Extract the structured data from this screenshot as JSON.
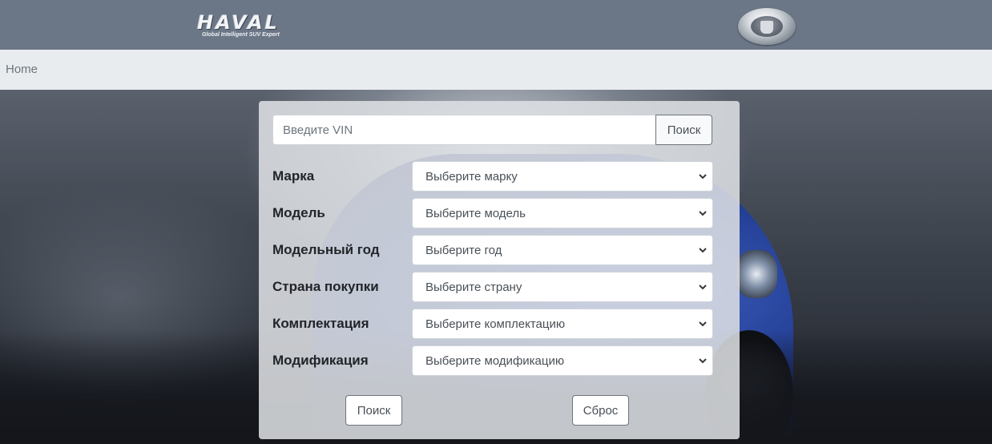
{
  "header": {
    "logo_text": "HAVAL",
    "logo_tagline": "Global Intelligent SUV Expert"
  },
  "breadcrumb": {
    "home_label": "Home"
  },
  "vin_search": {
    "placeholder": "Введите VIN",
    "button_label": "Поиск"
  },
  "filters": [
    {
      "label": "Марка",
      "value": "Выберите марку"
    },
    {
      "label": "Модель",
      "value": "Выберите модель"
    },
    {
      "label": "Модельный год",
      "value": "Выберите год"
    },
    {
      "label": "Страна покупки",
      "value": "Выберите страну"
    },
    {
      "label": "Комплектация",
      "value": "Выберите комплектацию"
    },
    {
      "label": "Модификация",
      "value": "Выберите модификацию"
    }
  ],
  "actions": {
    "search_label": "Поиск",
    "reset_label": "Сброс"
  },
  "colors": {
    "topbar": "#6b7686",
    "breadcrumb_bg": "#e9ecef",
    "panel_bg": "#dee0e4"
  }
}
